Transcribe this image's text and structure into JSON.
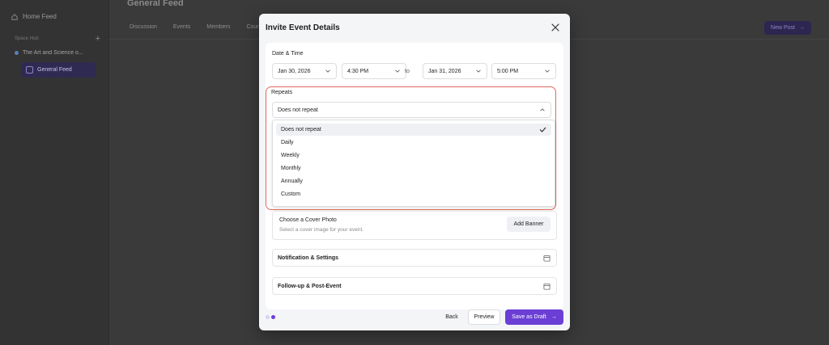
{
  "background": {
    "sidebar": {
      "home_label": "Home Feed",
      "section_label": "Space Hub",
      "course_label": "The Art and Science o...",
      "active_item": "General Feed"
    },
    "main": {
      "title": "General Feed",
      "tabs": [
        "Discussion",
        "Events",
        "Members",
        "Cour"
      ],
      "new_post_label": "New Post"
    }
  },
  "modal": {
    "title": "Invite Event Details",
    "date_time": {
      "label": "Date & Time",
      "start_date": "Jan 30, 2026",
      "start_time": "4:30 PM",
      "separator": "to",
      "end_date": "Jan 31, 2026",
      "end_time": "5:00 PM"
    },
    "repeats": {
      "label": "Repeats",
      "selected": "Does not repeat",
      "options": [
        "Does not repeat",
        "Daily",
        "Weekly",
        "Monthly",
        "Annually",
        "Custom"
      ]
    },
    "cover": {
      "title": "Choose a Cover Photo",
      "subtitle": "Select a cover image for your event.",
      "button": "Add Banner"
    },
    "sections": {
      "notifications": "Notification & Settings",
      "followup": "Follow-up & Post-Event"
    },
    "footer": {
      "back": "Back",
      "preview": "Preview",
      "save_draft": "Save as Draft"
    }
  },
  "colors": {
    "accent": "#6b3fd6",
    "highlight": "#e06a5a"
  }
}
